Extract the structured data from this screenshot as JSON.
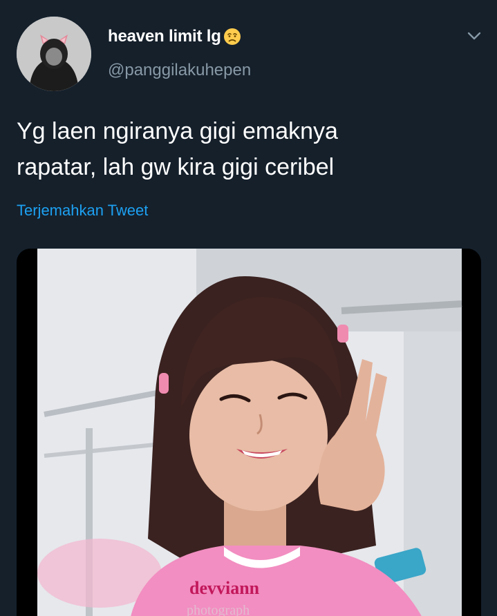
{
  "user": {
    "display_name": "heaven limit lg",
    "emoji_icon": "confused-face-emoji",
    "handle": "@panggilakuhepen"
  },
  "tweet": {
    "text": "Yg laen ngiranya gigi emaknya\nrapatar, lah gw kira gigi ceribel",
    "translate_label": "Terjemahkan Tweet"
  },
  "media": {
    "watermark_line1": "devviann",
    "watermark_line2": "photograph"
  },
  "colors": {
    "background": "#15202b",
    "text_primary": "#ffffff",
    "text_secondary": "#8899a6",
    "link": "#1da1f2"
  }
}
